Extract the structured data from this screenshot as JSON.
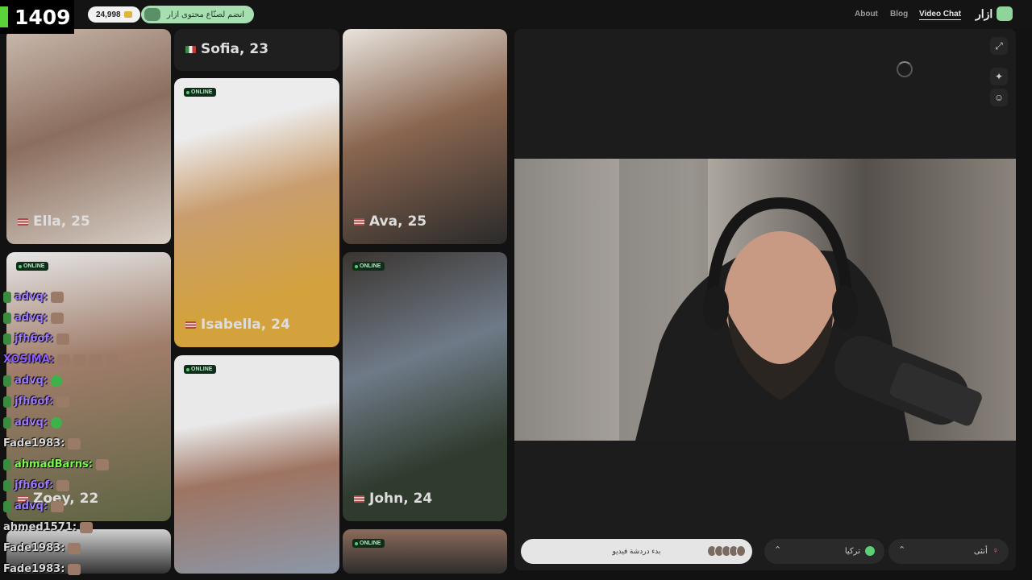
{
  "overlay": {
    "viewer_count": "1409"
  },
  "header": {
    "coins": "24,998",
    "creator_cta": "انضم لصنّاع محتوى ازار",
    "nav": {
      "about": "About",
      "blog": "Blog",
      "video_chat": "Video Chat"
    },
    "brand": "ازار"
  },
  "gallery": {
    "online_label": "ONLINE",
    "tiles": [
      {
        "name": "Ella, 25",
        "flag": "us"
      },
      {
        "name": "Sofia, 23",
        "flag": "it"
      },
      {
        "name": "Isabella, 24",
        "flag": "us"
      },
      {
        "name": "Ava, 25",
        "flag": "us"
      },
      {
        "name": "Zoey, 22",
        "flag": "us"
      },
      {
        "name": "John, 24",
        "flag": "us"
      }
    ]
  },
  "chat": [
    {
      "user": "advq:",
      "color": "#9f7bff"
    },
    {
      "user": "advq:",
      "color": "#9f7bff"
    },
    {
      "user": "jfh6of:",
      "color": "#9f7bff"
    },
    {
      "user": "XOSIMA:",
      "color": "#8a5cff"
    },
    {
      "user": "advq:",
      "color": "#9f7bff"
    },
    {
      "user": "jfh6of:",
      "color": "#9f7bff"
    },
    {
      "user": "advq:",
      "color": "#9f7bff"
    },
    {
      "user": "Fade1983:",
      "color": "#d8d8d8"
    },
    {
      "user": "ahmadBarns:",
      "color": "#7cfc4a"
    },
    {
      "user": "jfh6of:",
      "color": "#9f7bff"
    },
    {
      "user": "advq:",
      "color": "#9f7bff"
    },
    {
      "user": "ahmed1571:",
      "color": "#d8d8d8"
    },
    {
      "user": "Fade1983:",
      "color": "#d8d8d8"
    },
    {
      "user": "Fade1983:",
      "color": "#d8d8d8"
    }
  ],
  "controls": {
    "start_label": "بدء دردشة فيديو",
    "country": "تركيا",
    "gender": "أنثى"
  },
  "icons": {
    "expand": "expand-icon",
    "effects": "sparkle-icon",
    "face": "face-filter-icon",
    "caret": "chevron-up-icon"
  }
}
